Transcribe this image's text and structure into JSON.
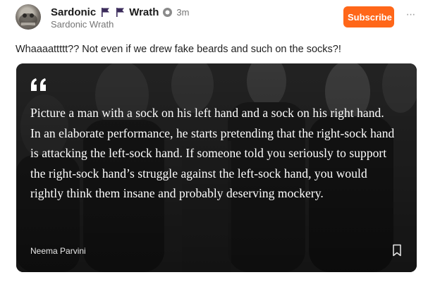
{
  "post": {
    "author_name": "Sardonic",
    "publication_name": "Wrath",
    "time_ago": "3m",
    "handle": "Sardonic Wrath",
    "subscribe_label": "Subscribe",
    "body_text": "Whaaaattttt?? Not even if we drew fake beards and such on the socks?!"
  },
  "quote": {
    "text": "Picture a man with a sock on his left hand and a sock on his right hand. In an elaborate performance, he starts pretending that the right-sock hand is attacking the left-sock hand. If someone told you seriously to support the right-sock hand’s struggle against the left-sock hand, you would rightly think them insane and probably deserving mockery.",
    "author": "Neema Parvini"
  },
  "colors": {
    "accent": "#ff6719",
    "flag": "#3a2a5a",
    "muted_text": "#757575",
    "card_bg": "#262626"
  },
  "icons": [
    "avatar-image",
    "flag-icon",
    "verified-icon",
    "more-options-icon",
    "quote-mark-icon",
    "bookmark-icon"
  ]
}
